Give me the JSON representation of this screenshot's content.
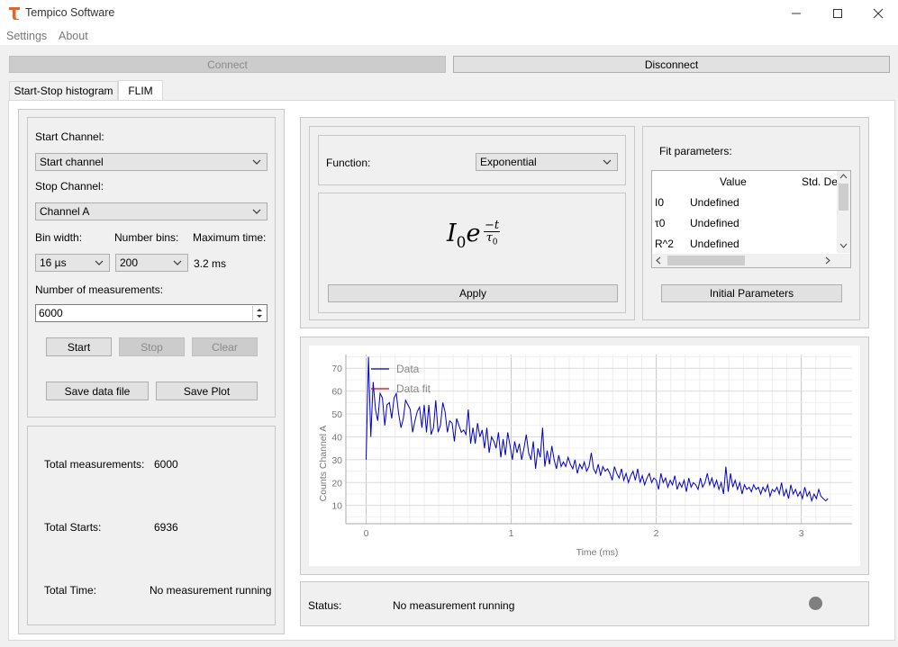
{
  "window": {
    "title": "Tempico Software",
    "controls": [
      "—",
      "☐",
      "✕"
    ]
  },
  "menu": {
    "items": [
      "Settings",
      "About"
    ]
  },
  "connection": {
    "connect_label": "Connect",
    "disconnect_label": "Disconnect"
  },
  "tabs": [
    {
      "label": "Start-Stop histogram",
      "active": false
    },
    {
      "label": "FLIM",
      "active": true
    }
  ],
  "controls": {
    "start_channel_label": "Start Channel:",
    "start_channel_value": "Start channel",
    "stop_channel_label": "Stop Channel:",
    "stop_channel_value": "Channel A",
    "bin_width_label": "Bin width:",
    "bin_width_value": "16 µs",
    "number_bins_label": "Number bins:",
    "number_bins_value": "200",
    "max_time_label": "Maximum time:",
    "max_time_value": "3.2 ms",
    "num_measurements_label": "Number of measurements:",
    "num_measurements_value": "6000",
    "start_label": "Start",
    "stop_label": "Stop",
    "clear_label": "Clear",
    "save_data_label": "Save data file",
    "save_plot_label": "Save Plot"
  },
  "summary": {
    "total_measurements_label": "Total measurements:",
    "total_measurements_value": "6000",
    "total_starts_label": "Total Starts:",
    "total_starts_value": "6936",
    "total_time_label": "Total Time:",
    "total_time_value": "No measurement running"
  },
  "fit": {
    "function_label": "Function:",
    "function_value": "Exponential",
    "formula": {
      "base": "I",
      "base_sub": "0",
      "exp_e": "e",
      "numerator": "−t",
      "denominator": "τ",
      "denominator_sub": "0"
    },
    "apply_label": "Apply",
    "params_label": "Fit parameters:",
    "table_headers": [
      "Value",
      "Std. De"
    ],
    "rows": [
      {
        "name": "I0",
        "value": "Undefined"
      },
      {
        "name": "τ0",
        "value": "Undefined"
      },
      {
        "name": "R^2",
        "value": "Undefined"
      }
    ],
    "initial_params_label": "Initial Parameters"
  },
  "status": {
    "label": "Status:",
    "value": "No measurement running",
    "indicator_color": "#7f7f7f"
  },
  "chart_data": {
    "type": "line",
    "xlabel": "Time (ms)",
    "ylabel": "Counts Channel A",
    "xlim": [
      -0.14,
      3.35
    ],
    "ylim": [
      2,
      76
    ],
    "xticks": [
      0,
      1,
      2,
      3
    ],
    "yticks": [
      10,
      20,
      30,
      40,
      50,
      60,
      70
    ],
    "grid": true,
    "legend_position": "top-left",
    "series": [
      {
        "name": "Data",
        "color": "#0000cc",
        "x_start": 0,
        "x_step": 0.016,
        "values": [
          30,
          75,
          40,
          64,
          52,
          47,
          59,
          57,
          45,
          54,
          55,
          48,
          57,
          59,
          50,
          44,
          48,
          56,
          54,
          52,
          42,
          47,
          51,
          53,
          44,
          54,
          42,
          54,
          41,
          44,
          56,
          42,
          45,
          55,
          51,
          42,
          47,
          46,
          38,
          48,
          45,
          42,
          43,
          41,
          52,
          37,
          44,
          37,
          46,
          40,
          43,
          35,
          44,
          33,
          40,
          38,
          35,
          42,
          31,
          39,
          32,
          42,
          36,
          30,
          38,
          33,
          37,
          30,
          35,
          41,
          33,
          30,
          38,
          26,
          35,
          31,
          44,
          27,
          34,
          28,
          36,
          30,
          26,
          32,
          27,
          29,
          27,
          31,
          28,
          26,
          30,
          24,
          28,
          26,
          29,
          25,
          27,
          33,
          26,
          24,
          28,
          23,
          27,
          25,
          26,
          24,
          21,
          27,
          24,
          22,
          26,
          21,
          24,
          20,
          23,
          25,
          21,
          26,
          20,
          23,
          19,
          22,
          24,
          20,
          22,
          21,
          17,
          24,
          20,
          22,
          18,
          21,
          19,
          23,
          17,
          20,
          18,
          21,
          16,
          22,
          18,
          20,
          19,
          17,
          22,
          18,
          20,
          24,
          19,
          22,
          18,
          21,
          17,
          20,
          15,
          27,
          16,
          24,
          18,
          21,
          17,
          20,
          15,
          19,
          17,
          18,
          16,
          19,
          17,
          18,
          15,
          18,
          16,
          19,
          14,
          17,
          16,
          18,
          15,
          20,
          14,
          17,
          13,
          19,
          15,
          17,
          14,
          16,
          13,
          18,
          14,
          16,
          12,
          15,
          13,
          17,
          14,
          13,
          12,
          13
        ]
      },
      {
        "name": "Data fit",
        "color": "#cc0000",
        "values": []
      }
    ]
  }
}
